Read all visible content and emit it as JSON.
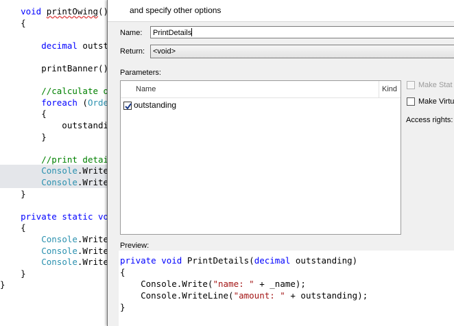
{
  "editor": {
    "lines": [
      {
        "segments": [
          {
            "t": "    "
          },
          {
            "t": "void",
            "c": "kw"
          },
          {
            "t": " "
          },
          {
            "t": "printOwing",
            "c": "sq"
          },
          {
            "t": "()"
          }
        ]
      },
      {
        "segments": [
          {
            "t": "    {"
          }
        ]
      },
      {
        "segments": [
          {
            "t": ""
          }
        ]
      },
      {
        "segments": [
          {
            "t": "        "
          },
          {
            "t": "decimal",
            "c": "kw"
          },
          {
            "t": " outst"
          }
        ]
      },
      {
        "segments": [
          {
            "t": ""
          }
        ]
      },
      {
        "segments": [
          {
            "t": "        printBanner()"
          }
        ]
      },
      {
        "segments": [
          {
            "t": ""
          }
        ]
      },
      {
        "segments": [
          {
            "t": "        "
          },
          {
            "t": "//calculate o",
            "c": "cm"
          }
        ]
      },
      {
        "segments": [
          {
            "t": "        "
          },
          {
            "t": "foreach",
            "c": "kw"
          },
          {
            "t": " ("
          },
          {
            "t": "Orde",
            "c": "ty"
          }
        ]
      },
      {
        "segments": [
          {
            "t": "        {"
          }
        ]
      },
      {
        "segments": [
          {
            "t": "            outstandi"
          }
        ]
      },
      {
        "segments": [
          {
            "t": "        }"
          }
        ]
      },
      {
        "segments": [
          {
            "t": ""
          }
        ]
      },
      {
        "segments": [
          {
            "t": "        "
          },
          {
            "t": "//print detai",
            "c": "cm"
          }
        ]
      },
      {
        "segments": [
          {
            "t": "        "
          },
          {
            "t": "Console",
            "c": "ty"
          },
          {
            "t": ".Write"
          }
        ],
        "hl": true
      },
      {
        "segments": [
          {
            "t": "        "
          },
          {
            "t": "Console",
            "c": "ty"
          },
          {
            "t": ".Write"
          }
        ],
        "hl": true
      },
      {
        "segments": [
          {
            "t": "    }"
          }
        ]
      },
      {
        "segments": [
          {
            "t": ""
          }
        ]
      },
      {
        "segments": [
          {
            "t": "    "
          },
          {
            "t": "private",
            "c": "kw"
          },
          {
            "t": " "
          },
          {
            "t": "static",
            "c": "kw"
          },
          {
            "t": " "
          },
          {
            "t": "vo",
            "c": "kw"
          }
        ]
      },
      {
        "segments": [
          {
            "t": "    {"
          }
        ]
      },
      {
        "segments": [
          {
            "t": "        "
          },
          {
            "t": "Console",
            "c": "ty"
          },
          {
            "t": ".Write"
          }
        ]
      },
      {
        "segments": [
          {
            "t": "        "
          },
          {
            "t": "Console",
            "c": "ty"
          },
          {
            "t": ".Write"
          }
        ]
      },
      {
        "segments": [
          {
            "t": "        "
          },
          {
            "t": "Console",
            "c": "ty"
          },
          {
            "t": ".Write"
          }
        ]
      },
      {
        "segments": [
          {
            "t": "    }"
          }
        ]
      },
      {
        "segments": [
          {
            "t": "}"
          }
        ]
      }
    ]
  },
  "dialog": {
    "subtitle": "and specify other options",
    "name_label": "Name:",
    "name_value": "PrintDetails",
    "return_label": "Return:",
    "return_value": "<void>",
    "parameters_label": "Parameters:",
    "columns": {
      "name": "Name",
      "kind": "Kind"
    },
    "parameters": [
      {
        "name": "outstanding",
        "checked": true
      }
    ],
    "options": {
      "make_static": "Make Stat",
      "make_static_enabled": false,
      "make_virtual": "Make Virtu",
      "access_rights": "Access rights:"
    },
    "preview_label": "Preview:",
    "preview_lines": [
      {
        "segments": [
          {
            "t": "private",
            "c": "kw"
          },
          {
            "t": " "
          },
          {
            "t": "void",
            "c": "kw"
          },
          {
            "t": " PrintDetails("
          },
          {
            "t": "decimal",
            "c": "kw"
          },
          {
            "t": " outstanding)"
          }
        ]
      },
      {
        "segments": [
          {
            "t": "{"
          }
        ]
      },
      {
        "segments": [
          {
            "t": "    Console.Write("
          },
          {
            "t": "\"name: \"",
            "c": "str"
          },
          {
            "t": " + _name);"
          }
        ]
      },
      {
        "segments": [
          {
            "t": "    Console.WriteLine("
          },
          {
            "t": "\"amount: \"",
            "c": "str"
          },
          {
            "t": " + outstanding);"
          }
        ]
      },
      {
        "segments": [
          {
            "t": "}"
          }
        ]
      }
    ]
  }
}
